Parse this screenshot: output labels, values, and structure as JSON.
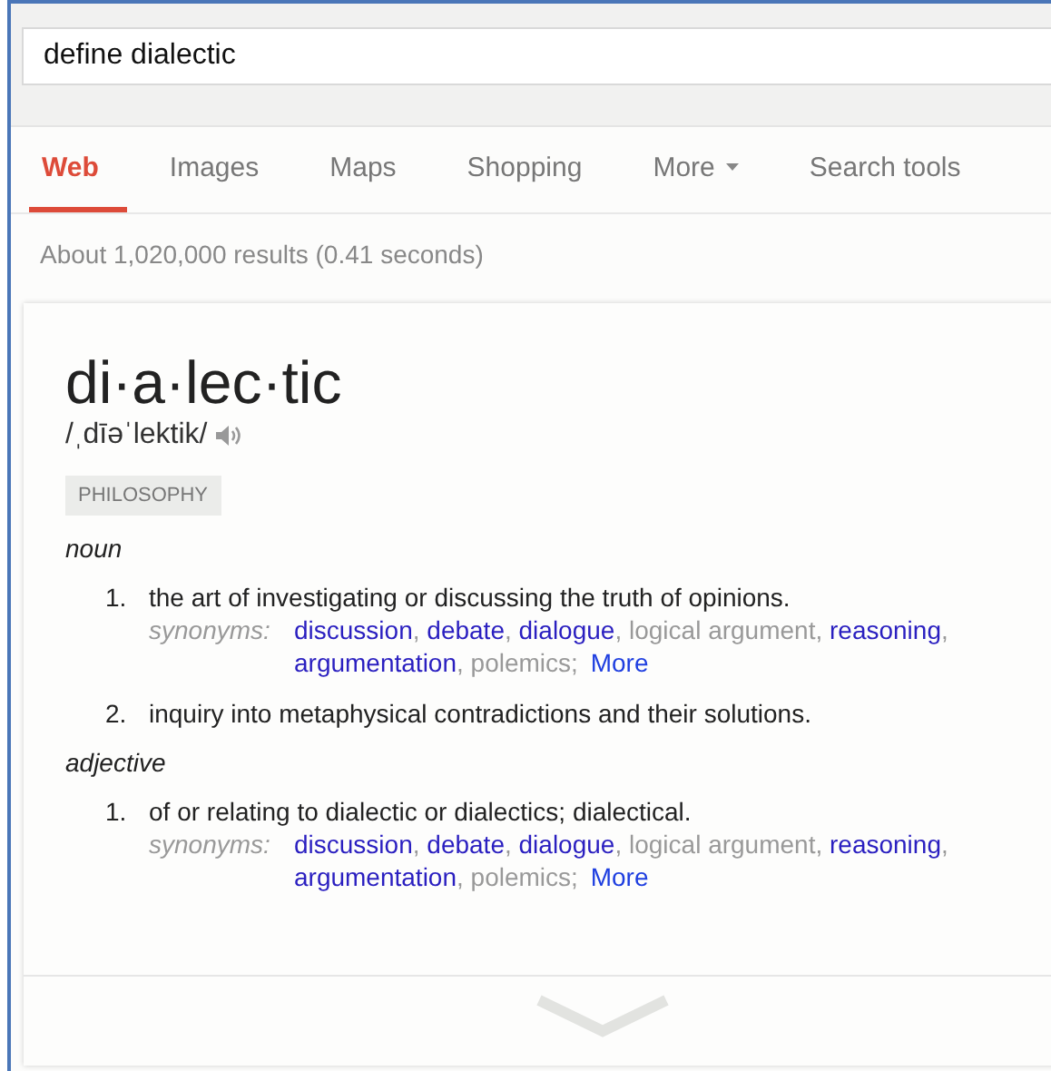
{
  "search": {
    "value": "define dialectic"
  },
  "tabs": [
    {
      "label": "Web",
      "selected": true,
      "kind": "tab"
    },
    {
      "label": "Images",
      "selected": false,
      "kind": "tab"
    },
    {
      "label": "Maps",
      "selected": false,
      "kind": "tab"
    },
    {
      "label": "Shopping",
      "selected": false,
      "kind": "tab"
    },
    {
      "label": "More",
      "selected": false,
      "kind": "menu"
    },
    {
      "label": "Search tools",
      "selected": false,
      "kind": "tab"
    }
  ],
  "result_stats": "About 1,020,000 results (0.41 seconds)",
  "definition": {
    "headword": "di·a·lec·tic",
    "pronunciation": "/ˌdīəˈlektik/",
    "domain": "PHILOSOPHY",
    "senses": [
      {
        "part_of_speech": "noun",
        "meanings": [
          {
            "number": "1.",
            "text": "the art of investigating or discussing the truth of opinions.",
            "synonyms_label": "synonyms:",
            "synonyms": [
              {
                "word": "discussion",
                "linked": true
              },
              {
                "word": "debate",
                "linked": true
              },
              {
                "word": "dialogue",
                "linked": true
              },
              {
                "word": "logical argument",
                "linked": false
              },
              {
                "word": "reasoning",
                "linked": true
              },
              {
                "word": "argumentation",
                "linked": true
              },
              {
                "word": "polemics",
                "linked": false
              }
            ],
            "separator": ",",
            "terminator": ";",
            "more": "More"
          },
          {
            "number": "2.",
            "text": "inquiry into metaphysical contradictions and their solutions."
          }
        ]
      },
      {
        "part_of_speech": "adjective",
        "meanings": [
          {
            "number": "1.",
            "text": "of or relating to dialectic or dialectics; dialectical.",
            "synonyms_label": "synonyms:",
            "synonyms": [
              {
                "word": "discussion",
                "linked": true
              },
              {
                "word": "debate",
                "linked": true
              },
              {
                "word": "dialogue",
                "linked": true
              },
              {
                "word": "logical argument",
                "linked": false
              },
              {
                "word": "reasoning",
                "linked": true
              },
              {
                "word": "argumentation",
                "linked": true
              },
              {
                "word": "polemics",
                "linked": false
              }
            ],
            "separator": ",",
            "terminator": ";",
            "more": "More"
          }
        ]
      }
    ]
  }
}
